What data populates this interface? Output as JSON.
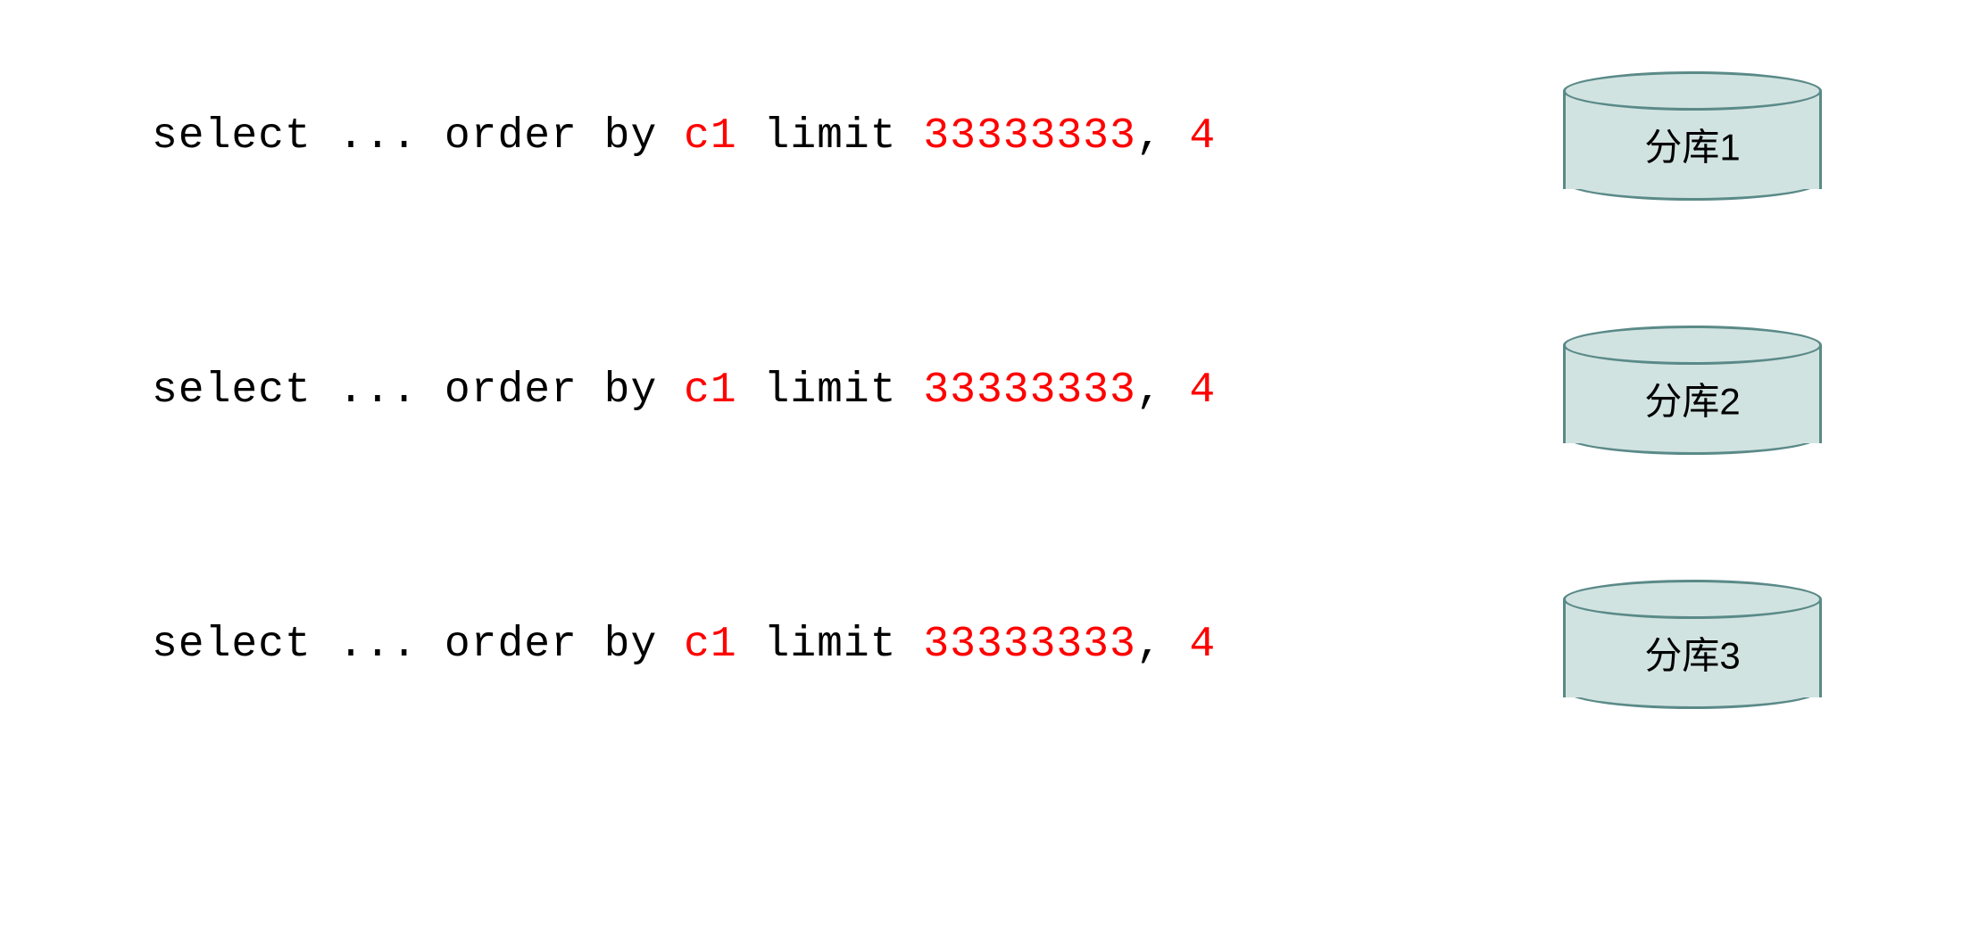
{
  "rows": [
    {
      "sql": {
        "prefix": "select ... order by ",
        "column": "c1",
        "mid": " limit ",
        "offset": "33333333",
        "comma": ", ",
        "count": "4"
      },
      "db_label": "分库1"
    },
    {
      "sql": {
        "prefix": "select ... order by ",
        "column": "c1",
        "mid": " limit ",
        "offset": "33333333",
        "comma": ", ",
        "count": "4"
      },
      "db_label": "分库2"
    },
    {
      "sql": {
        "prefix": "select ... order by ",
        "column": "c1",
        "mid": " limit ",
        "offset": "33333333",
        "comma": ", ",
        "count": "4"
      },
      "db_label": "分库3"
    }
  ]
}
